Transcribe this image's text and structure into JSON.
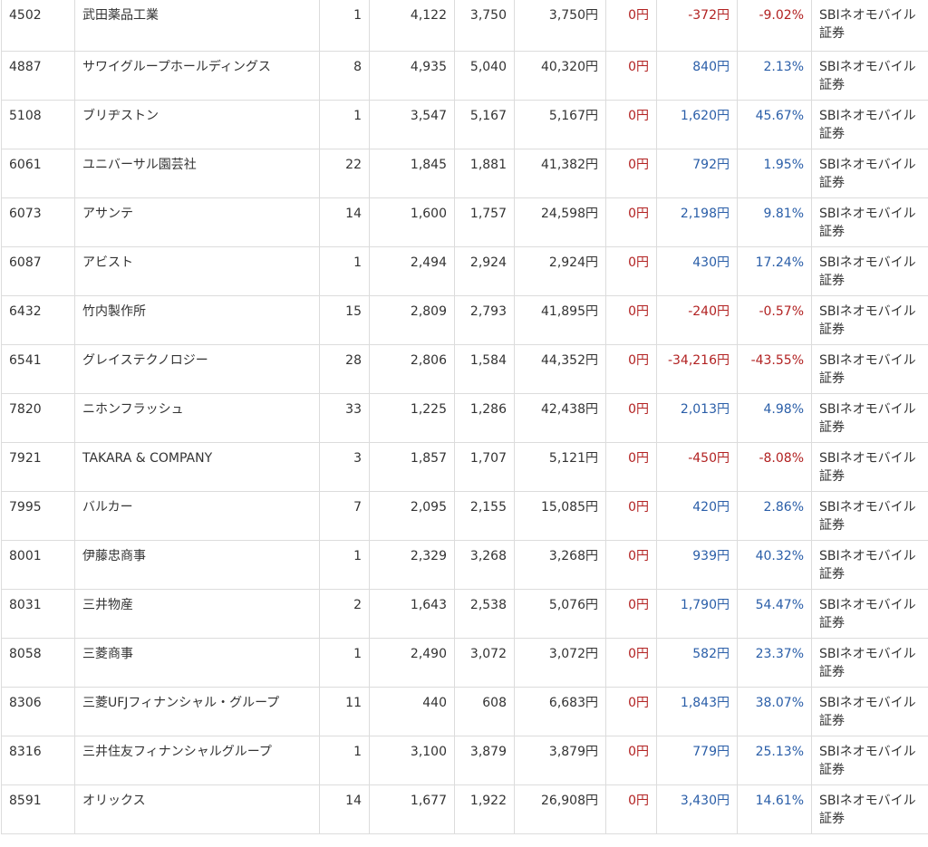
{
  "colors": {
    "negative": "#b22222",
    "positive": "#2a5ea8",
    "border": "#dcdcdc",
    "text": "#333333"
  },
  "rows": [
    {
      "code": "4502",
      "name": "武田薬品工業",
      "qty": "1",
      "buy": "4,122",
      "price": "3,750",
      "value": "3,750円",
      "div": "0円",
      "pl": "-372円",
      "pct": "-9.02%",
      "sign": "neg",
      "broker": "SBIネオモバイル証券"
    },
    {
      "code": "4887",
      "name": "サワイグループホールディングス",
      "qty": "8",
      "buy": "4,935",
      "price": "5,040",
      "value": "40,320円",
      "div": "0円",
      "pl": "840円",
      "pct": "2.13%",
      "sign": "pos",
      "broker": "SBIネオモバイル証券"
    },
    {
      "code": "5108",
      "name": "ブリヂストン",
      "qty": "1",
      "buy": "3,547",
      "price": "5,167",
      "value": "5,167円",
      "div": "0円",
      "pl": "1,620円",
      "pct": "45.67%",
      "sign": "pos",
      "broker": "SBIネオモバイル証券"
    },
    {
      "code": "6061",
      "name": "ユニバーサル園芸社",
      "qty": "22",
      "buy": "1,845",
      "price": "1,881",
      "value": "41,382円",
      "div": "0円",
      "pl": "792円",
      "pct": "1.95%",
      "sign": "pos",
      "broker": "SBIネオモバイル証券"
    },
    {
      "code": "6073",
      "name": "アサンテ",
      "qty": "14",
      "buy": "1,600",
      "price": "1,757",
      "value": "24,598円",
      "div": "0円",
      "pl": "2,198円",
      "pct": "9.81%",
      "sign": "pos",
      "broker": "SBIネオモバイル証券"
    },
    {
      "code": "6087",
      "name": "アビスト",
      "qty": "1",
      "buy": "2,494",
      "price": "2,924",
      "value": "2,924円",
      "div": "0円",
      "pl": "430円",
      "pct": "17.24%",
      "sign": "pos",
      "broker": "SBIネオモバイル証券"
    },
    {
      "code": "6432",
      "name": "竹内製作所",
      "qty": "15",
      "buy": "2,809",
      "price": "2,793",
      "value": "41,895円",
      "div": "0円",
      "pl": "-240円",
      "pct": "-0.57%",
      "sign": "neg",
      "broker": "SBIネオモバイル証券"
    },
    {
      "code": "6541",
      "name": "グレイステクノロジー",
      "qty": "28",
      "buy": "2,806",
      "price": "1,584",
      "value": "44,352円",
      "div": "0円",
      "pl": "-34,216円",
      "pct": "-43.55%",
      "sign": "neg",
      "broker": "SBIネオモバイル証券"
    },
    {
      "code": "7820",
      "name": "ニホンフラッシュ",
      "qty": "33",
      "buy": "1,225",
      "price": "1,286",
      "value": "42,438円",
      "div": "0円",
      "pl": "2,013円",
      "pct": "4.98%",
      "sign": "pos",
      "broker": "SBIネオモバイル証券"
    },
    {
      "code": "7921",
      "name": "TAKARA & COMPANY",
      "qty": "3",
      "buy": "1,857",
      "price": "1,707",
      "value": "5,121円",
      "div": "0円",
      "pl": "-450円",
      "pct": "-8.08%",
      "sign": "neg",
      "broker": "SBIネオモバイル証券"
    },
    {
      "code": "7995",
      "name": "バルカー",
      "qty": "7",
      "buy": "2,095",
      "price": "2,155",
      "value": "15,085円",
      "div": "0円",
      "pl": "420円",
      "pct": "2.86%",
      "sign": "pos",
      "broker": "SBIネオモバイル証券"
    },
    {
      "code": "8001",
      "name": "伊藤忠商事",
      "qty": "1",
      "buy": "2,329",
      "price": "3,268",
      "value": "3,268円",
      "div": "0円",
      "pl": "939円",
      "pct": "40.32%",
      "sign": "pos",
      "broker": "SBIネオモバイル証券"
    },
    {
      "code": "8031",
      "name": "三井物産",
      "qty": "2",
      "buy": "1,643",
      "price": "2,538",
      "value": "5,076円",
      "div": "0円",
      "pl": "1,790円",
      "pct": "54.47%",
      "sign": "pos",
      "broker": "SBIネオモバイル証券"
    },
    {
      "code": "8058",
      "name": "三菱商事",
      "qty": "1",
      "buy": "2,490",
      "price": "3,072",
      "value": "3,072円",
      "div": "0円",
      "pl": "582円",
      "pct": "23.37%",
      "sign": "pos",
      "broker": "SBIネオモバイル証券"
    },
    {
      "code": "8306",
      "name": "三菱UFJフィナンシャル・グループ",
      "qty": "11",
      "buy": "440",
      "price": "608",
      "value": "6,683円",
      "div": "0円",
      "pl": "1,843円",
      "pct": "38.07%",
      "sign": "pos",
      "broker": "SBIネオモバイル証券"
    },
    {
      "code": "8316",
      "name": "三井住友フィナンシャルグループ",
      "qty": "1",
      "buy": "3,100",
      "price": "3,879",
      "value": "3,879円",
      "div": "0円",
      "pl": "779円",
      "pct": "25.13%",
      "sign": "pos",
      "broker": "SBIネオモバイル証券"
    },
    {
      "code": "8591",
      "name": "オリックス",
      "qty": "14",
      "buy": "1,677",
      "price": "1,922",
      "value": "26,908円",
      "div": "0円",
      "pl": "3,430円",
      "pct": "14.61%",
      "sign": "pos",
      "broker": "SBIネオモバイル証券"
    }
  ]
}
